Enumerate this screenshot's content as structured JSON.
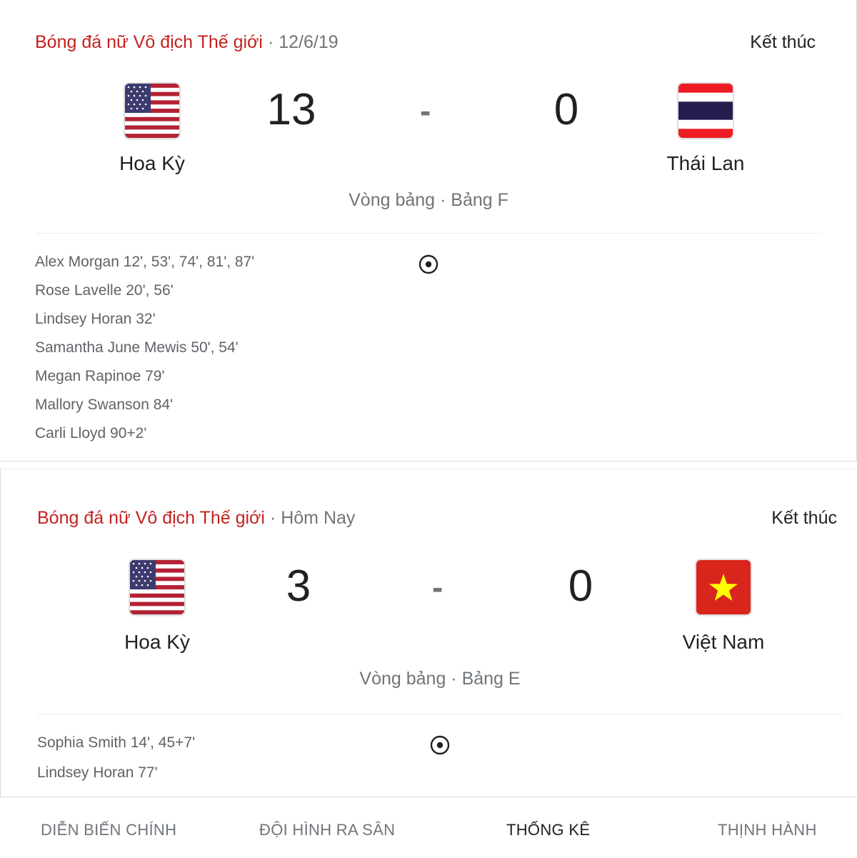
{
  "matches": [
    {
      "league": "Bóng đá nữ Vô địch Thế giới",
      "separator": "·",
      "date": "12/6/19",
      "status": "Kết thúc",
      "home": {
        "name": "Hoa Kỳ",
        "score": "13",
        "flag": "us-flag-icon"
      },
      "away": {
        "name": "Thái Lan",
        "score": "0",
        "flag": "thailand-flag-icon"
      },
      "dash": "-",
      "stage": "Vòng bảng · Bảng F",
      "goal_icon": "soccer-ball-icon",
      "scorers": [
        "Alex Morgan 12', 53', 74', 81', 87'",
        "Rose Lavelle 20', 56'",
        "Lindsey Horan 32'",
        "Samantha June Mewis 50', 54'",
        "Megan Rapinoe 79'",
        "Mallory Swanson 84'",
        "Carli Lloyd 90+2'"
      ]
    },
    {
      "league": "Bóng đá nữ Vô địch Thế giới",
      "separator": "·",
      "date": "Hôm Nay",
      "status": "Kết thúc",
      "home": {
        "name": "Hoa Kỳ",
        "score": "3",
        "flag": "us-flag-icon"
      },
      "away": {
        "name": "Việt Nam",
        "score": "0",
        "flag": "vietnam-flag-icon"
      },
      "dash": "-",
      "stage": "Vòng bảng · Bảng E",
      "goal_icon": "soccer-ball-icon",
      "scorers": [
        "Sophia Smith 14', 45+7'",
        "Lindsey Horan 77'"
      ]
    }
  ],
  "tabs": [
    {
      "label": "DIỄN BIẾN CHÍNH",
      "active": false
    },
    {
      "label": "ĐỘI HÌNH RA SÂN",
      "active": false
    },
    {
      "label": "THỐNG KÊ",
      "active": true
    },
    {
      "label": "THỊNH HÀNH",
      "active": false
    }
  ],
  "colors": {
    "league_red": "#c5221f",
    "muted_gray": "#70757a",
    "text_dark": "#202124"
  }
}
